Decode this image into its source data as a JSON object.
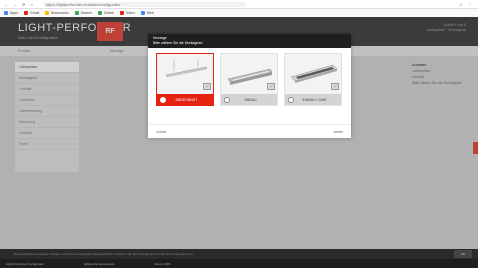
{
  "browser": {
    "url": "https://lightperformer.example/configurator",
    "nav": [
      "←",
      "→",
      "⟳",
      "⌂"
    ],
    "actions": [
      "☆",
      "⋮"
    ],
    "bookmarks": [
      {
        "label": "Apps",
        "color": "#4285f4"
      },
      {
        "label": "Gmail",
        "color": "#e42313"
      },
      {
        "label": "Bookmarks",
        "color": "#fbbc05"
      },
      {
        "label": "Search",
        "color": "#34a853"
      },
      {
        "label": "Online",
        "color": "#34a853"
      },
      {
        "label": "Video",
        "color": "#e42313"
      },
      {
        "label": "Web",
        "color": "#4285f4"
      }
    ]
  },
  "app": {
    "logo": "LIGHT-PERFORMER",
    "tagline": "Das Licht-Konfigurator",
    "badge": "RF",
    "step_info": "Schritt 1 von 8",
    "step_sub": "Lichtsystem · Montageart"
  },
  "subbar": {
    "left": "Produkt",
    "middle": "Montage"
  },
  "sidebar": {
    "items": [
      {
        "label": "Lichtsystem"
      },
      {
        "label": "Montageart"
      },
      {
        "label": "Leuchte"
      },
      {
        "label": "Lichtfarbe"
      },
      {
        "label": "Lichtverteilung"
      },
      {
        "label": "Steuerung"
      },
      {
        "label": "Zubehör"
      },
      {
        "label": "Farbe"
      }
    ]
  },
  "rightpanel": {
    "title": "Auswahl",
    "items": [
      "Lichtsystem",
      "Leuchte",
      "Bitte wählen Sie die Montageart"
    ]
  },
  "dialog": {
    "title": "Montage",
    "subtitle": "Bitte wählen Sie die Montageart",
    "options": [
      {
        "label": "ABGEHÄNGT",
        "selected": true,
        "icon": "pendant-luminaire-icon"
      },
      {
        "label": "ANBAU",
        "selected": false,
        "icon": "surface-luminaire-icon"
      },
      {
        "label": "EINBAU / LINE",
        "selected": false,
        "icon": "recessed-luminaire-icon"
      }
    ],
    "back": "zurück",
    "next": "weiter"
  },
  "infobar": {
    "text": "Diese Website verwendet Cookies, um Ihnen ein optimales Nutzererlebnis zu bieten. Mit der Nutzung stimmen Sie der Verwendung zu.",
    "button": "OK"
  },
  "taskbar": {
    "left": "Light-Performer Konfigurator",
    "middle": "lightperformer.example",
    "right": "Zoom 100%"
  },
  "colors": {
    "accent": "#e42313",
    "dark": "#1b1b1b"
  }
}
